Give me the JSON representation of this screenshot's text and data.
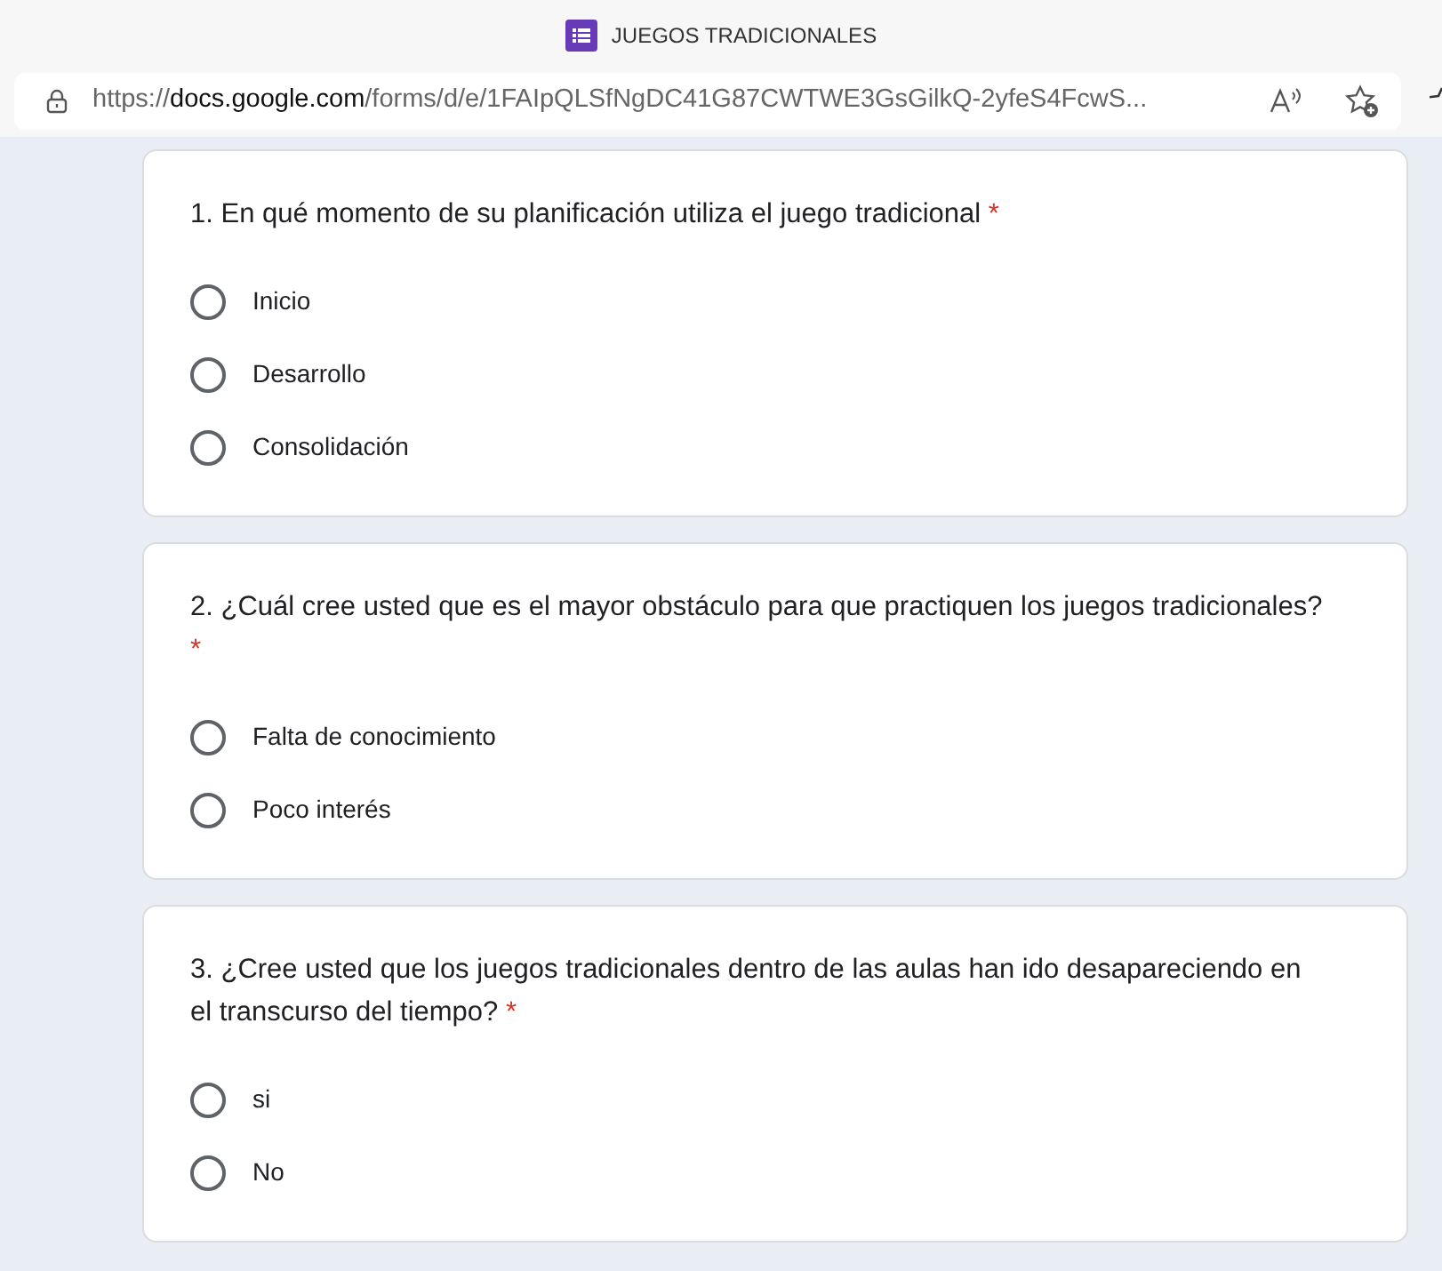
{
  "window": {
    "title": "JUEGOS TRADICIONALES"
  },
  "address_bar": {
    "url_prefix": "https://",
    "url_host": "docs.google.com",
    "url_path": "/forms/d/e/1FAIpQLSfNgDC41G87CWTWE3GsGilkQ-2yfeS4FcwS..."
  },
  "questions": [
    {
      "text": "1. En qué momento de su planificación utiliza el juego tradicional",
      "required_mark": "*",
      "options": [
        {
          "label": "Inicio",
          "selected": false
        },
        {
          "label": "Desarrollo",
          "selected": false
        },
        {
          "label": "Consolidación",
          "selected": false
        }
      ]
    },
    {
      "text": "2. ¿Cuál cree usted que es el mayor obstáculo para que practiquen los juegos tradicionales?",
      "required_mark": "*",
      "options": [
        {
          "label": "Falta de conocimiento",
          "selected": false
        },
        {
          "label": "Poco interés",
          "selected": false
        }
      ]
    },
    {
      "text": "3. ¿Cree usted que los juegos tradicionales dentro de las aulas han ido desapareciendo en el transcurso del tiempo?",
      "required_mark": "*",
      "options": [
        {
          "label": "si",
          "selected": false
        },
        {
          "label": "No",
          "selected": false
        }
      ]
    }
  ]
}
